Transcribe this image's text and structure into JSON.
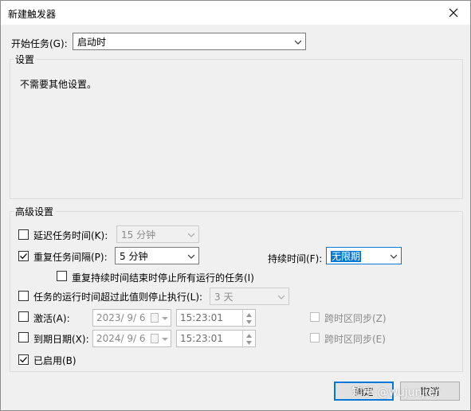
{
  "window": {
    "title": "新建触发器"
  },
  "begin_task": {
    "label": "开始任务(G):",
    "value": "启动时"
  },
  "settings_group": {
    "title": "设置",
    "message": "不需要其他设置。"
  },
  "advanced_group": {
    "title": "高级设置",
    "delay": {
      "label": "延迟任务时间(K):",
      "value": "15 分钟",
      "checked": false
    },
    "repeat": {
      "label": "重复任务间隔(P):",
      "value": "5 分钟",
      "checked": true
    },
    "duration": {
      "label": "持续时间(F):",
      "value": "无限期"
    },
    "stop_at_end": {
      "label": "重复持续时间结束时停止所有运行的任务(I)",
      "checked": false
    },
    "stop_if_longer": {
      "label": "任务的运行时间超过此值则停止执行(L):",
      "value": "3 天",
      "checked": false
    },
    "activate": {
      "label": "激活(A):",
      "date": "2023/  9/  6",
      "time": "15:23:01",
      "sync_label": "跨时区同步(Z)",
      "checked": false
    },
    "expire": {
      "label": "到期日期(X):",
      "date": "2024/  9/  6",
      "time": "15:23:01",
      "sync_label": "跨时区同步(E)",
      "checked": false
    },
    "enabled": {
      "label": "已启用(B)",
      "checked": true
    }
  },
  "buttons": {
    "ok": "确定",
    "cancel": "取消"
  },
  "watermark": "知乎 @wujunjier"
}
